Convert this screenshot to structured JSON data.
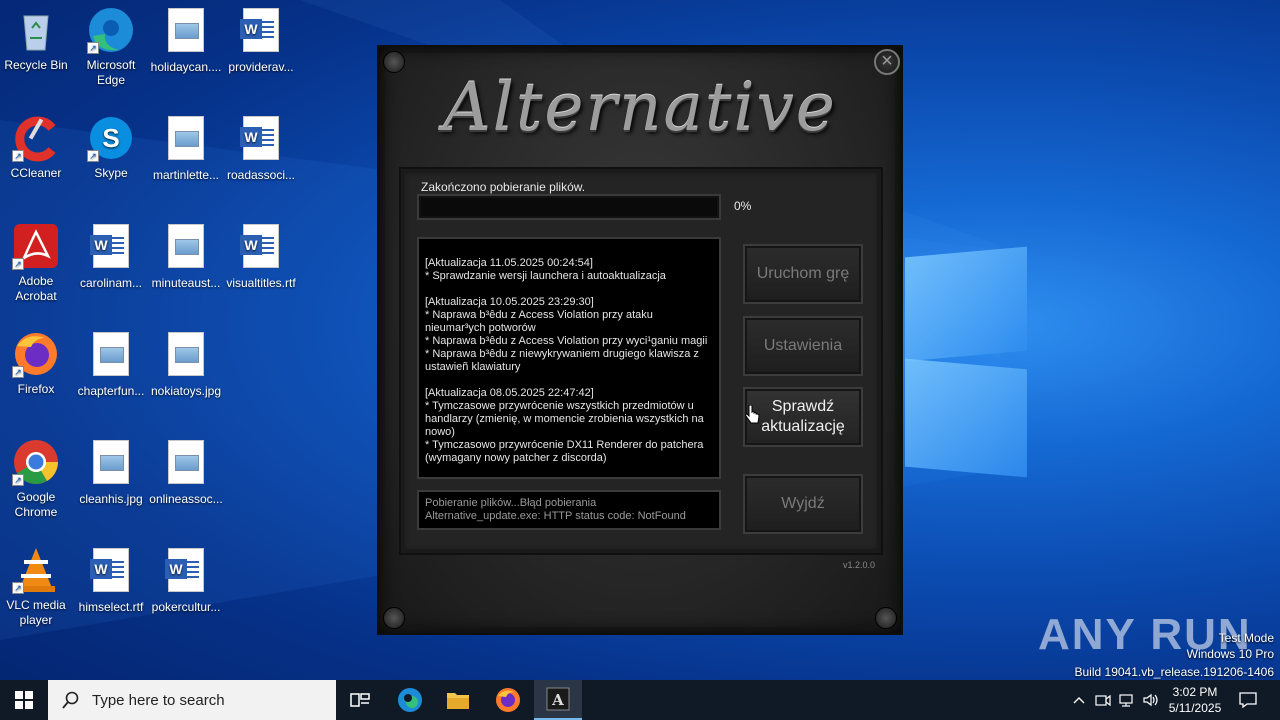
{
  "desktop": {
    "icons": [
      {
        "label": "Recycle Bin",
        "icon": "recycle-bin-icon"
      },
      {
        "label": "Microsoft Edge",
        "icon": "edge-icon"
      },
      {
        "label": "holidaycan....",
        "icon": "image-file-icon"
      },
      {
        "label": "providerav...",
        "icon": "word-doc-icon"
      },
      {
        "label": "CCleaner",
        "icon": "ccleaner-icon"
      },
      {
        "label": "Skype",
        "icon": "skype-icon"
      },
      {
        "label": "martinlette...",
        "icon": "image-file-icon"
      },
      {
        "label": "roadassoci...",
        "icon": "word-doc-icon"
      },
      {
        "label": "Adobe Acrobat",
        "icon": "acrobat-icon"
      },
      {
        "label": "carolinam...",
        "icon": "word-doc-icon"
      },
      {
        "label": "minuteaust...",
        "icon": "image-file-icon"
      },
      {
        "label": "visualtitles.rtf",
        "icon": "word-doc-icon"
      },
      {
        "label": "Firefox",
        "icon": "firefox-icon"
      },
      {
        "label": "chapterfun...",
        "icon": "image-file-icon"
      },
      {
        "label": "nokiatoys.jpg",
        "icon": "image-file-icon"
      },
      {
        "label": "Google Chrome",
        "icon": "chrome-icon"
      },
      {
        "label": "cleanhis.jpg",
        "icon": "image-file-icon"
      },
      {
        "label": "onlineassoc...",
        "icon": "image-file-icon"
      },
      {
        "label": "VLC media player",
        "icon": "vlc-icon"
      },
      {
        "label": "himselect.rtf",
        "icon": "word-doc-icon"
      },
      {
        "label": "pokercultur...",
        "icon": "word-doc-icon"
      }
    ]
  },
  "launcher": {
    "logo": "Alternative",
    "close_label": "×",
    "download_label": "Zakończono pobieranie plików.",
    "progress_percent": 0,
    "progress_text": "0%",
    "changelog": [
      {
        "header": "[Aktualizacja 11.05.2025 00:24:54]",
        "lines": [
          "* Sprawdzanie wersji launchera i autoaktualizacja"
        ]
      },
      {
        "header": "[Aktualizacja 10.05.2025 23:29:30]",
        "lines": [
          "* Naprawa b³êdu z Access Violation przy ataku nieumar³ych potworów",
          "* Naprawa b³êdu z Access Violation przy wyci¹ganiu magii",
          "* Naprawa b³êdu z niewykrywaniem drugiego klawisza z ustawieñ klawiatury"
        ]
      },
      {
        "header": "[Aktualizacja 08.05.2025 22:47:42]",
        "lines": [
          "* Tymczasowe przywrócenie wszystkich przedmiotów u handlarzy (zmienię, w momencie zrobienia wszystkich na nowo)",
          "* Tymczasowo przywrócenie DX11 Renderer do patchera (wymagany nowy patcher z discorda)"
        ]
      }
    ],
    "status": "Pobieranie plików...Błąd pobierania Alternative_update.exe: HTTP status code: NotFound",
    "buttons": {
      "play": "Uruchom grę",
      "settings": "Ustawienia",
      "check_updates": "Sprawdź aktualizację",
      "exit": "Wyjdź"
    },
    "version": "v1.2.0.0"
  },
  "watermark": {
    "brand": "ANY RUN",
    "mode": "Test Mode",
    "os": "Windows 10 Pro",
    "build": "Build 19041.vb_release.191206-1406"
  },
  "taskbar": {
    "search_placeholder": "Type here to search",
    "time": "3:02 PM",
    "date": "5/11/2025"
  }
}
